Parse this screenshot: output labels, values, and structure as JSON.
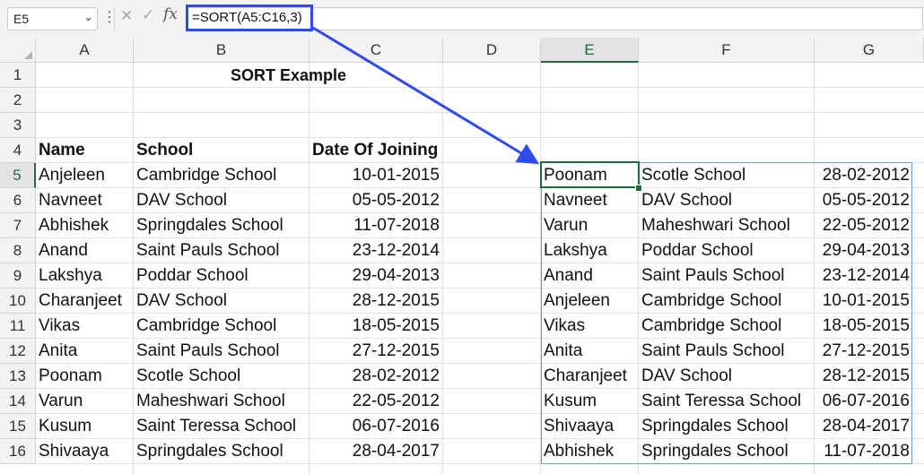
{
  "formula_bar": {
    "name_box": "E5",
    "formula": "=SORT(A5:C16,3)",
    "fx_label": "fx"
  },
  "columns": [
    "A",
    "B",
    "C",
    "D",
    "E",
    "F",
    "G"
  ],
  "rows": [
    "1",
    "2",
    "3",
    "4",
    "5",
    "6",
    "7",
    "8",
    "9",
    "10",
    "11",
    "12",
    "13",
    "14",
    "15",
    "16"
  ],
  "active_cell": {
    "column": "E",
    "row": "5"
  },
  "colors": {
    "accent_green": "#1d6b3b",
    "callout_blue": "#2e49ee",
    "spill_border": "#6a9bd1"
  },
  "sheet": {
    "title": "SORT Example",
    "headers": {
      "name": "Name",
      "school": "School",
      "date": "Date Of Joining"
    },
    "source": [
      {
        "name": "Anjeleen",
        "school": "Cambridge School",
        "date": "10-01-2015"
      },
      {
        "name": "Navneet",
        "school": "DAV School",
        "date": "05-05-2012"
      },
      {
        "name": "Abhishek",
        "school": "Springdales School",
        "date": "11-07-2018"
      },
      {
        "name": "Anand",
        "school": "Saint Pauls School",
        "date": "23-12-2014"
      },
      {
        "name": "Lakshya",
        "school": "Poddar School",
        "date": "29-04-2013"
      },
      {
        "name": "Charanjeet",
        "school": "DAV School",
        "date": "28-12-2015"
      },
      {
        "name": "Vikas",
        "school": "Cambridge School",
        "date": "18-05-2015"
      },
      {
        "name": "Anita",
        "school": "Saint Pauls School",
        "date": "27-12-2015"
      },
      {
        "name": "Poonam",
        "school": "Scotle School",
        "date": "28-02-2012"
      },
      {
        "name": "Varun",
        "school": "Maheshwari School",
        "date": "22-05-2012"
      },
      {
        "name": "Kusum",
        "school": "Saint Teressa School",
        "date": "06-07-2016"
      },
      {
        "name": "Shivaaya",
        "school": "Springdales School",
        "date": "28-04-2017"
      }
    ],
    "sorted": [
      {
        "name": "Poonam",
        "school": "Scotle School",
        "date": "28-02-2012"
      },
      {
        "name": "Navneet",
        "school": "DAV School",
        "date": "05-05-2012"
      },
      {
        "name": "Varun",
        "school": "Maheshwari School",
        "date": "22-05-2012"
      },
      {
        "name": "Lakshya",
        "school": "Poddar School",
        "date": "29-04-2013"
      },
      {
        "name": "Anand",
        "school": "Saint Pauls School",
        "date": "23-12-2014"
      },
      {
        "name": "Anjeleen",
        "school": "Cambridge School",
        "date": "10-01-2015"
      },
      {
        "name": "Vikas",
        "school": "Cambridge School",
        "date": "18-05-2015"
      },
      {
        "name": "Anita",
        "school": "Saint Pauls School",
        "date": "27-12-2015"
      },
      {
        "name": "Charanjeet",
        "school": "DAV School",
        "date": "28-12-2015"
      },
      {
        "name": "Kusum",
        "school": "Saint Teressa School",
        "date": "06-07-2016"
      },
      {
        "name": "Shivaaya",
        "school": "Springdales School",
        "date": "28-04-2017"
      },
      {
        "name": "Abhishek",
        "school": "Springdales School",
        "date": "11-07-2018"
      }
    ]
  }
}
